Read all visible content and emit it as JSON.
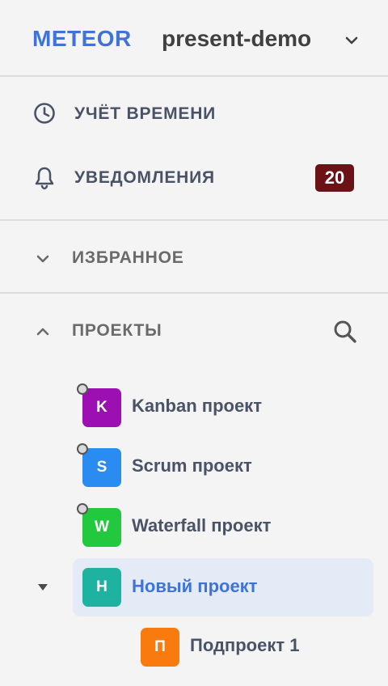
{
  "header": {
    "brand": "METEOR",
    "workspace": "present-demo",
    "chevron_icon": "chevron-down-icon"
  },
  "menu": [
    {
      "label": "УЧЁТ ВРЕМЕНИ",
      "icon": "clock-icon"
    },
    {
      "label": "УВЕДОМЛЕНИЯ",
      "icon": "bell-icon",
      "badge": "20"
    }
  ],
  "sections": {
    "favorites": {
      "label": "ИЗБРАННОЕ",
      "state": "collapsed"
    },
    "projects": {
      "label": "ПРОЕКТЫ",
      "state": "expanded",
      "search_icon": "search-icon"
    }
  },
  "projects": [
    {
      "initial": "K",
      "name": "Kanban проект",
      "color": "#9c0fb3"
    },
    {
      "initial": "S",
      "name": "Scrum проект",
      "color": "#2a8cf0"
    },
    {
      "initial": "W",
      "name": "Waterfall проект",
      "color": "#22c93f"
    },
    {
      "initial": "H",
      "name": "Новый проект",
      "color": "#1db3a0",
      "selected": true,
      "expanded": true
    },
    {
      "initial": "П",
      "name": "Подпроект 1",
      "color": "#f97a0f",
      "child": true
    }
  ],
  "colors": {
    "accent": "#3f73d6",
    "badge": "#6b1216",
    "selected_bg": "#e4ebf6"
  }
}
